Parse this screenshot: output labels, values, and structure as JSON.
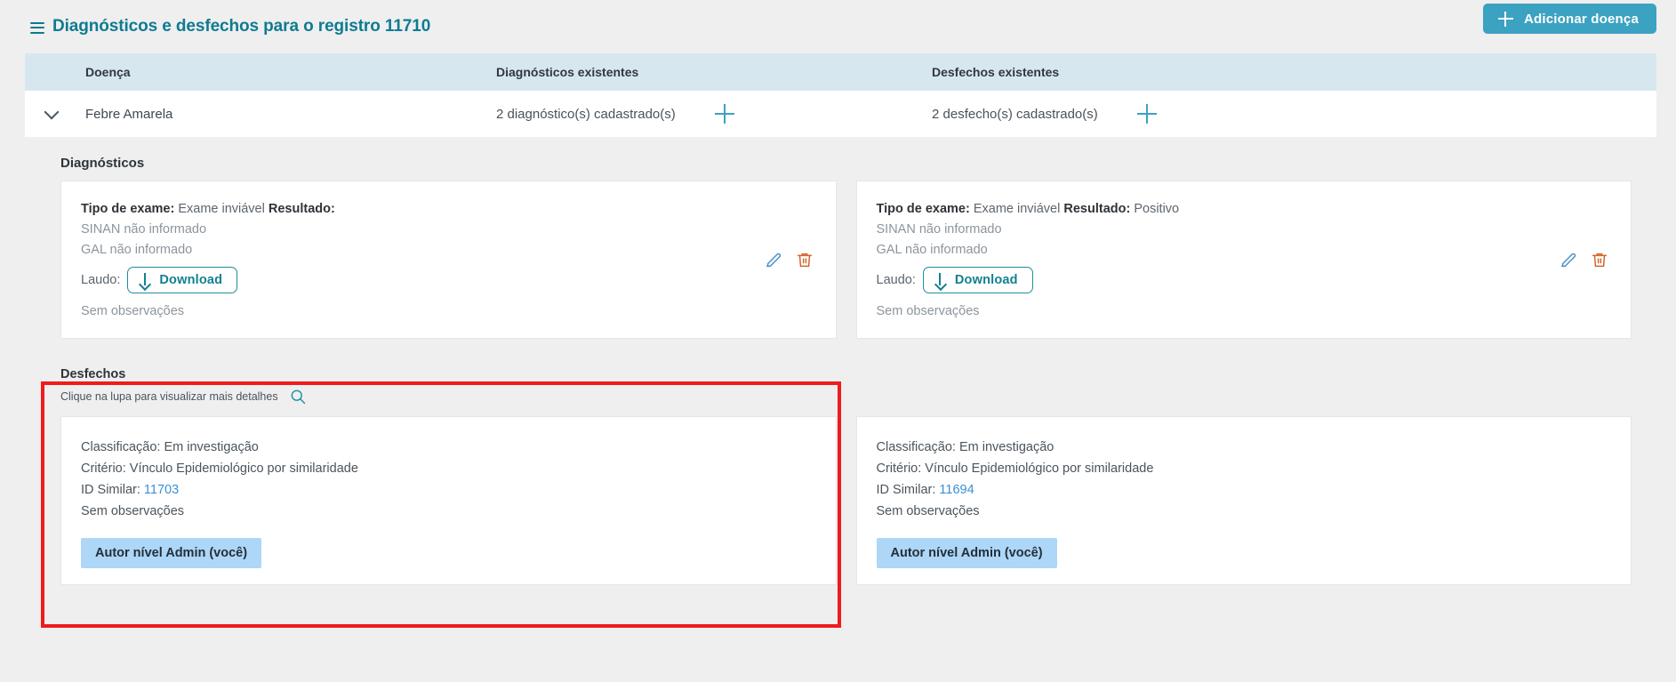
{
  "header": {
    "title": "Diagnósticos e desfechos para o registro 11710",
    "list_icon": "list-icon",
    "add_button": {
      "label": "Adicionar doença",
      "icon": "plus-icon"
    },
    "accent_color": "#0e7b92",
    "button_color": "#3ca2c2"
  },
  "table": {
    "columns": [
      "Doença",
      "Diagnósticos existentes",
      "Desfechos existentes"
    ],
    "rows": [
      {
        "expand_icon": "chevron-down-icon",
        "disease": "Febre Amarela",
        "diagnostics_count": "2 diagnóstico(s) cadastrado(s)",
        "add_diagnostic_icon": "plus-icon",
        "outcomes_count": "2 desfecho(s) cadastrado(s)",
        "add_outcome_icon": "plus-icon"
      }
    ]
  },
  "diagnostics": {
    "section_title": "Diagnósticos",
    "cards": [
      {
        "exam_type_label": "Tipo de exame:",
        "exam_type_value": "Exame inviável",
        "result_label": "Resultado:",
        "result_value": "",
        "sinan": "SINAN não informado",
        "gal": "GAL não informado",
        "laudo_label": "Laudo:",
        "download_label": "Download",
        "download_icon": "download-arrow-icon",
        "observations": "Sem observações",
        "edit_icon": "pencil-icon",
        "delete_icon": "trash-icon"
      },
      {
        "exam_type_label": "Tipo de exame:",
        "exam_type_value": "Exame inviável",
        "result_label": "Resultado:",
        "result_value": "Positivo",
        "sinan": "SINAN não informado",
        "gal": "GAL não informado",
        "laudo_label": "Laudo:",
        "download_label": "Download",
        "download_icon": "download-arrow-icon",
        "observations": "Sem observações",
        "edit_icon": "pencil-icon",
        "delete_icon": "trash-icon"
      }
    ]
  },
  "outcomes": {
    "section_title": "Desfechos",
    "hint": "Clique na lupa para visualizar mais detalhes",
    "hint_icon": "magnifier-icon",
    "highlight_color": "#ee1c1c",
    "cards": [
      {
        "classification": "Classificação: Em investigação",
        "criterion": "Critério: Vínculo Epidemiológico por similaridade",
        "similar_label": "ID Similar:",
        "similar_id": "11703",
        "observations": "Sem observações",
        "author_badge": "Autor nível Admin (você)"
      },
      {
        "classification": "Classificação: Em investigação",
        "criterion": "Critério: Vínculo Epidemiológico por similaridade",
        "similar_label": "ID Similar:",
        "similar_id": "11694",
        "observations": "Sem observações",
        "author_badge": "Autor nível Admin (você)"
      }
    ]
  }
}
